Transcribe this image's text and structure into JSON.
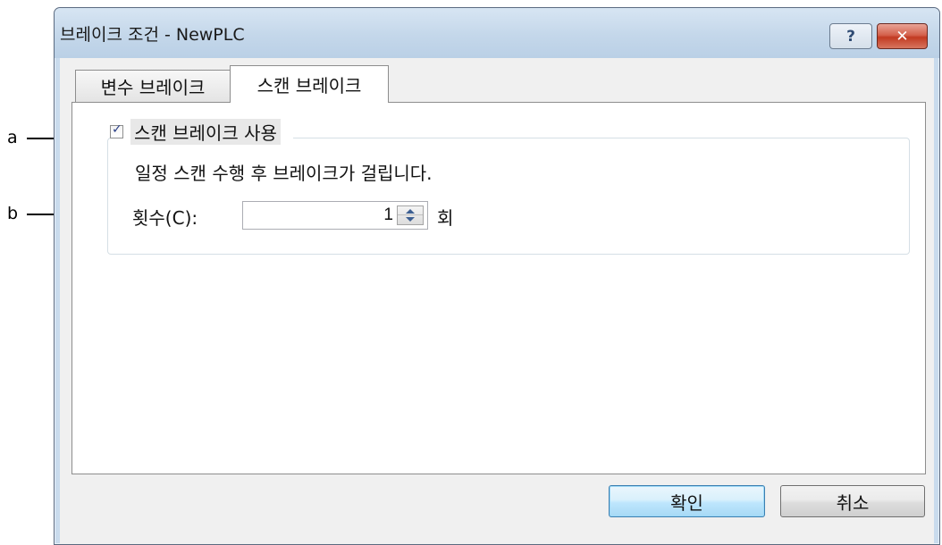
{
  "annotations": {
    "a": "a",
    "b": "b"
  },
  "window": {
    "title": "브레이크 조건 - NewPLC",
    "help_label": "?",
    "close_label": "✕"
  },
  "tabs": [
    {
      "label": "변수 브레이크",
      "selected": false
    },
    {
      "label": "스캔 브레이크",
      "selected": true
    }
  ],
  "scan_break": {
    "use_label": "스캔 브레이크 사용",
    "use_checked": true,
    "description": "일정 스캔 수행 후 브레이크가 걸립니다.",
    "count_label": "횟수(C):",
    "count_value": "1",
    "count_unit": "회"
  },
  "buttons": {
    "ok": "확인",
    "cancel": "취소"
  }
}
